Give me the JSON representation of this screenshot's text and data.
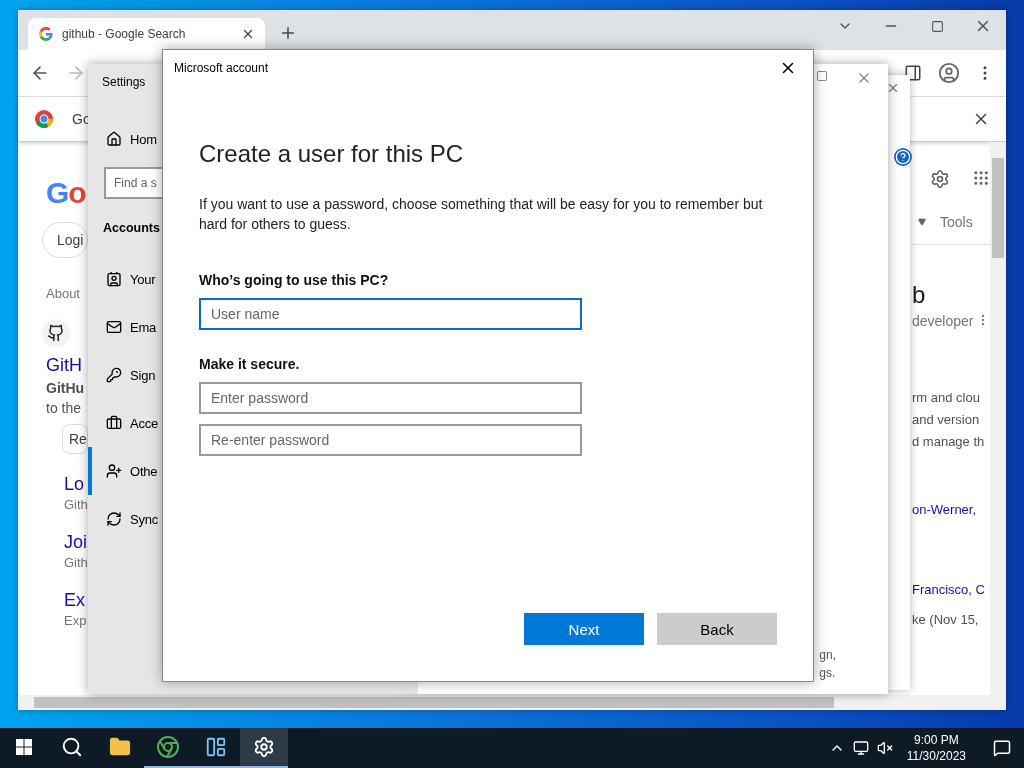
{
  "browser": {
    "tab": {
      "title": "github - Google Search",
      "selected": true
    },
    "infobar": {
      "text": "Go"
    },
    "left": {
      "logo": "Go",
      "chip": "Logi",
      "about": "About",
      "result_title": "GitH",
      "snippet_bold": "GitHu",
      "snippet": "to the",
      "button": "Re",
      "links": [
        {
          "title": "Lo",
          "source": "Gith"
        },
        {
          "title": "Joi",
          "source": "Gith"
        },
        {
          "title": "Ex",
          "source": "Exp"
        }
      ]
    },
    "right": {
      "tools": "Tools",
      "heading": "b",
      "subtitle": "developer",
      "lines": [
        "rm and clou",
        "and version",
        "d manage th"
      ],
      "link_lines": [
        "on-Werner,",
        "Francisco, C"
      ],
      "date_line": "ke (Nov 15,"
    }
  },
  "settings": {
    "title": "Settings",
    "home": "Hom",
    "search": {
      "placeholder": "Find a s"
    },
    "section": "Accounts",
    "nav": [
      {
        "label": "Your",
        "selected": false
      },
      {
        "label": "Ema",
        "selected": false
      },
      {
        "label": "Sign",
        "selected": false
      },
      {
        "label": "Acce",
        "selected": false
      },
      {
        "label": "Othe",
        "selected": true
      },
      {
        "label": "Sync",
        "selected": false
      }
    ],
    "footer_lines": [
      "gn,",
      "gs."
    ]
  },
  "dialog": {
    "title": "Microsoft account",
    "heading": "Create a user for this PC",
    "intro": "If you want to use a password, choose something that will be easy for you to remember but hard for others to guess.",
    "user_label": "Who’s going to use this PC?",
    "user_field": {
      "placeholder": "User name",
      "focused": true
    },
    "secure_label": "Make it secure.",
    "password_fields": [
      {
        "placeholder": "Enter password",
        "focused": false
      },
      {
        "placeholder": "Re-enter password",
        "focused": false
      }
    ],
    "buttons": [
      {
        "label": "Next",
        "kind": "primary"
      },
      {
        "label": "Back",
        "kind": "secondary"
      }
    ]
  },
  "taskbar": {
    "items": [
      {
        "running": false,
        "selected": false
      },
      {
        "running": false,
        "selected": false
      },
      {
        "running": false,
        "selected": false
      },
      {
        "running": true,
        "selected": false
      },
      {
        "running": true,
        "selected": false
      },
      {
        "running": true,
        "selected": true
      }
    ],
    "time": "9:00 PM",
    "date": "11/30/2023"
  }
}
